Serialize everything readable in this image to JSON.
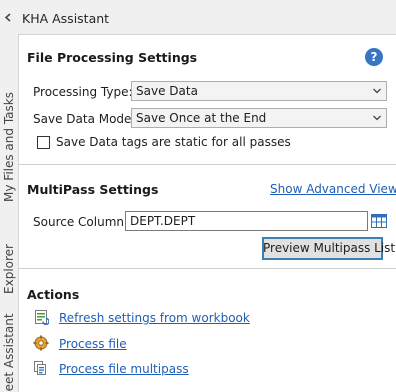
{
  "window": {
    "title": "KHA Assistant"
  },
  "side_tabs": [
    {
      "label": "My Files and Tasks"
    },
    {
      "label": "Explorer"
    },
    {
      "label": "Sheet Assistant"
    }
  ],
  "file_processing": {
    "title": "File Processing Settings",
    "help_icon": "?",
    "processing_type": {
      "label": "Processing Type:",
      "value": "Save Data"
    },
    "save_data_mode": {
      "label": "Save Data Mode:",
      "value": "Save Once at the End"
    },
    "static_tags_checkbox": {
      "label": "Save Data tags are static for all passes",
      "checked": false
    }
  },
  "multipass": {
    "title": "MultiPass Settings",
    "advanced_link": "Show Advanced View",
    "source_column": {
      "label": "Source Column:",
      "value": "DEPT.DEPT"
    },
    "preview_button": "Preview Multipass List"
  },
  "actions": {
    "title": "Actions",
    "items": [
      {
        "label": "Refresh settings from workbook",
        "icon": "refresh-workbook-icon"
      },
      {
        "label": "Process file",
        "icon": "process-file-icon"
      },
      {
        "label": "Process file multipass",
        "icon": "process-multipass-icon"
      }
    ]
  },
  "colors": {
    "link": "#1f5fb8",
    "help_icon": "#3a75c4",
    "panel_bg": "#ffffff",
    "chrome_bg": "#f0f0f0"
  }
}
